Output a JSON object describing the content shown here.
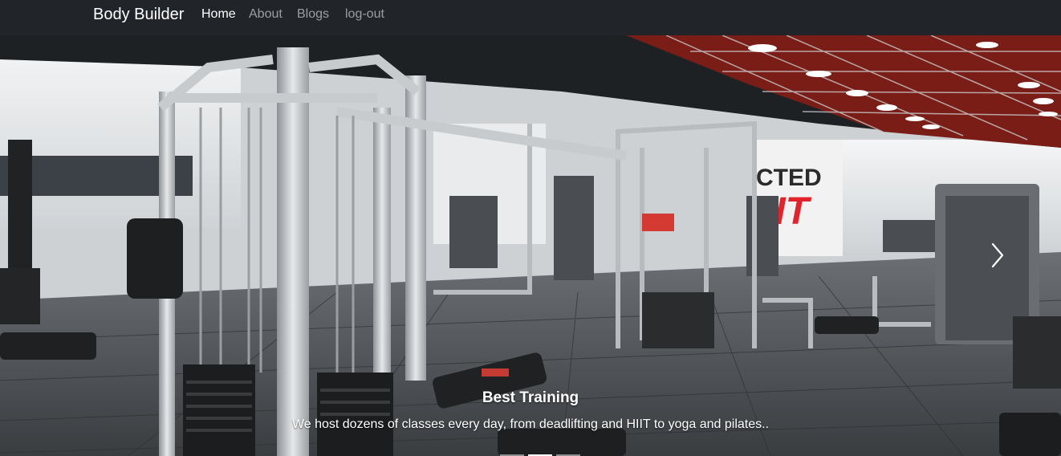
{
  "navbar": {
    "brand": "Body Builder",
    "links": [
      {
        "label": "Home",
        "active": true
      },
      {
        "label": "About",
        "active": false
      },
      {
        "label": "Blogs",
        "active": false
      },
      {
        "label": "log-out",
        "active": false
      }
    ]
  },
  "carousel": {
    "caption_title": "Best Training",
    "caption_text": "We host dozens of classes every day, from deadlifting and HIIT to yoga and pilates..",
    "active_slide": 2,
    "slide_count": 3,
    "next_icon": "chevron-right-icon",
    "prev_icon": "chevron-left-icon",
    "wall_sign": "CTED HIIT"
  },
  "colors": {
    "navbar_bg": "#212529",
    "nav_active": "#ffffff",
    "nav_muted": "rgba(255,255,255,0.55)",
    "sign_red": "#e3232b"
  }
}
